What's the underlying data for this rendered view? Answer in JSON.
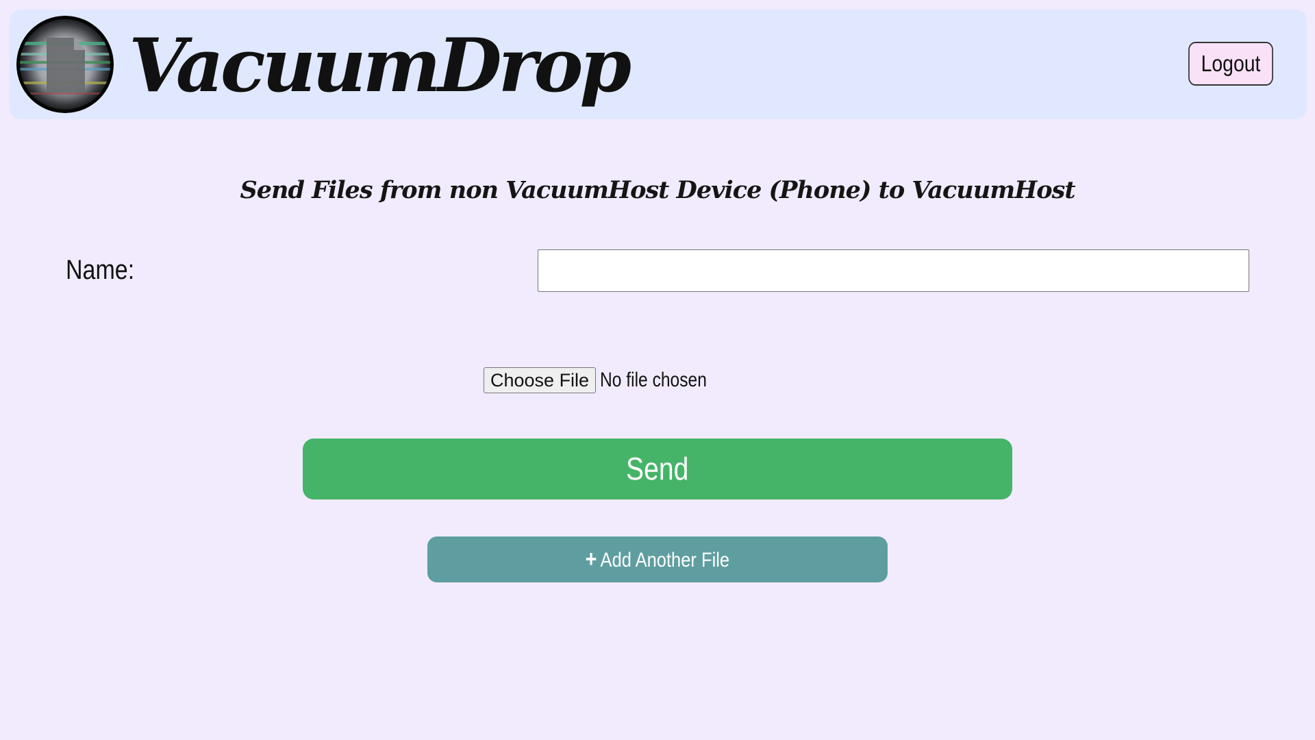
{
  "header": {
    "brand": "VacuumDrop",
    "logo_icon": "file-lens-logo-icon",
    "logout_label": "Logout"
  },
  "main": {
    "heading": "Send Files from non VacuumHost Device (Phone) to VacuumHost",
    "name_label": "Name:",
    "name_value": "",
    "name_placeholder": "",
    "choose_file_label": "Choose File",
    "no_file_text": "No file chosen",
    "send_label": "Send",
    "add_icon": "plus-icon",
    "add_plus": "+",
    "add_label": "Add Another File"
  },
  "colors": {
    "page_background": "#f1ebfd",
    "header_background": "#e0e8ff",
    "logout_background": "#f9e1f7",
    "send_button": "#45b468",
    "add_button": "#5f9ea0"
  }
}
